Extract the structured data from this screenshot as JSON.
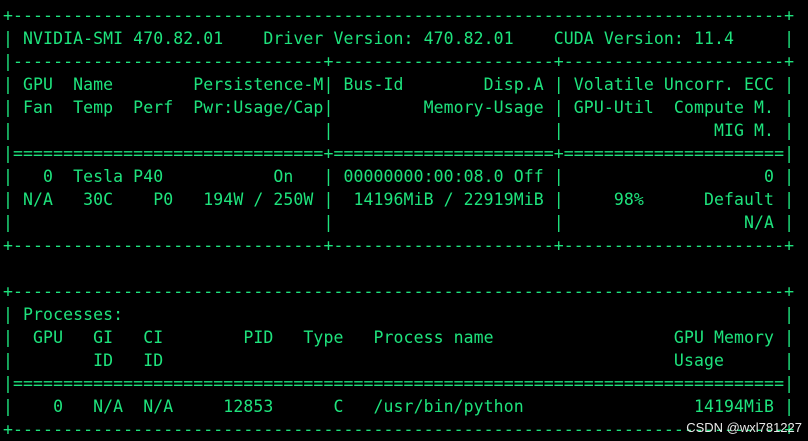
{
  "terminal": {
    "fg_color": "#1ee37d",
    "bg_color": "#000000",
    "lines": [
      "+-----------------------------------------------------------------------------+",
      "| NVIDIA-SMI 470.82.01    Driver Version: 470.82.01    CUDA Version: 11.4     |",
      "|-------------------------------+----------------------+----------------------+",
      "| GPU  Name        Persistence-M| Bus-Id        Disp.A | Volatile Uncorr. ECC |",
      "| Fan  Temp  Perf  Pwr:Usage/Cap|         Memory-Usage | GPU-Util  Compute M. |",
      "|                               |                      |               MIG M. |",
      "|===============================+======================+======================|",
      "|   0  Tesla P40           On   | 00000000:00:08.0 Off |                    0 |",
      "| N/A   30C    P0   194W / 250W |  14196MiB / 22919MiB |     98%      Default |",
      "|                               |                      |                  N/A |",
      "+-------------------------------+----------------------+----------------------+",
      "",
      "+-----------------------------------------------------------------------------+",
      "| Processes:                                                                  |",
      "|  GPU   GI   CI        PID   Type   Process name                  GPU Memory |",
      "|        ID   ID                                                   Usage      |",
      "|=============================================================================|",
      "|    0   N/A  N/A     12853      C   /usr/bin/python                 14194MiB |",
      "+-----------------------------------------------------------------------------+"
    ]
  },
  "watermark": {
    "text": "CSDN @wxl781227",
    "color": "#e9e9e9"
  }
}
